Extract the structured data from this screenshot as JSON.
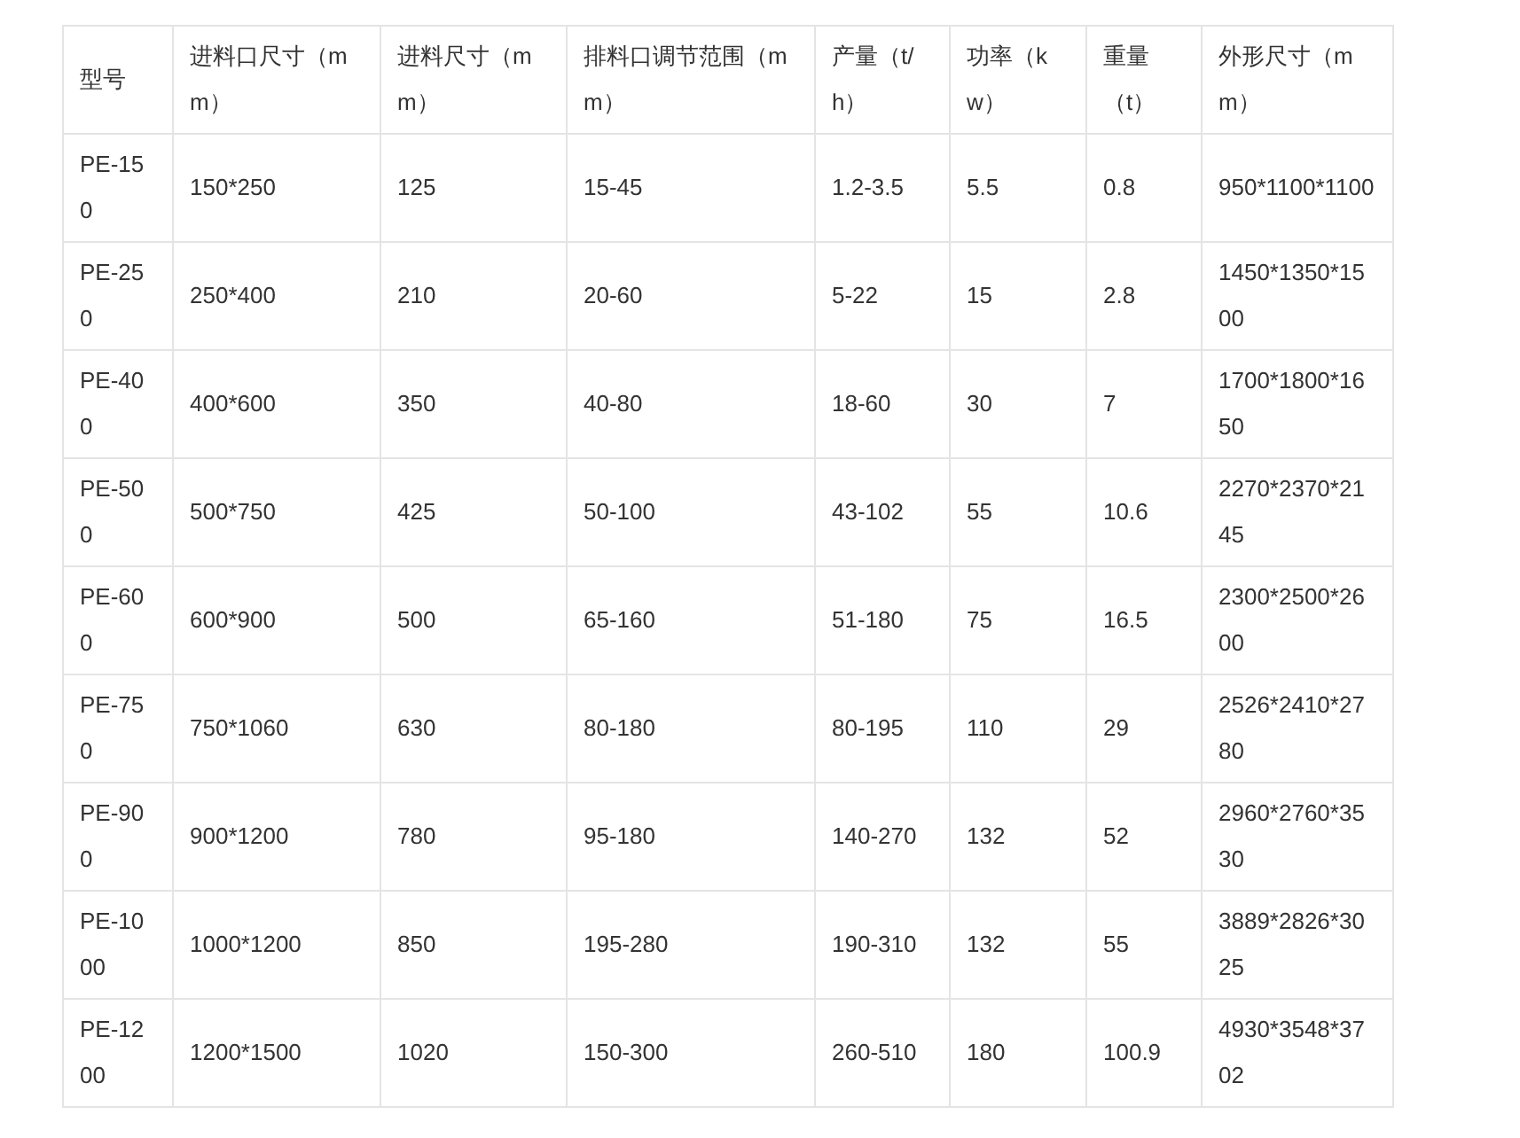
{
  "table": {
    "columns": [
      "型号",
      "进料口尺寸（mm）",
      "进料尺寸（mm）",
      "排料口调节范围（mm）",
      "产量（t/h）",
      "功率（kw）",
      "重量（t）",
      "外形尺寸（mm）"
    ],
    "rows": [
      [
        "PE-150",
        "150*250",
        "125",
        "15-45",
        "1.2-3.5",
        "5.5",
        "0.8",
        "950*1100*1100"
      ],
      [
        "PE-250",
        "250*400",
        "210",
        "20-60",
        "5-22",
        "15",
        "2.8",
        "1450*1350*1500"
      ],
      [
        "PE-400",
        "400*600",
        "350",
        "40-80",
        "18-60",
        "30",
        "7",
        "1700*1800*1650"
      ],
      [
        "PE-500",
        "500*750",
        "425",
        "50-100",
        "43-102",
        "55",
        "10.6",
        "2270*2370*2145"
      ],
      [
        "PE-600",
        "600*900",
        "500",
        "65-160",
        "51-180",
        "75",
        "16.5",
        "2300*2500*2600"
      ],
      [
        "PE-750",
        "750*1060",
        "630",
        "80-180",
        "80-195",
        "110",
        "29",
        "2526*2410*2780"
      ],
      [
        "PE-900",
        "900*1200",
        "780",
        "95-180",
        "140-270",
        "132",
        "52",
        "2960*2760*3530"
      ],
      [
        "PE-1000",
        "1000*1200",
        "850",
        "195-280",
        "190-310",
        "132",
        "55",
        "3889*2826*3025"
      ],
      [
        "PE-1200",
        "1200*1500",
        "1020",
        "150-300",
        "260-510",
        "180",
        "100.9",
        "4930*3548*3702"
      ]
    ]
  }
}
